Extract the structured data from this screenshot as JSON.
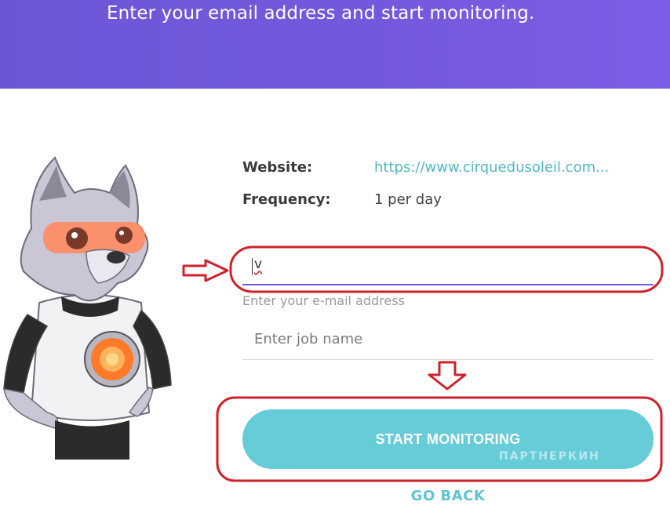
{
  "hero": {
    "tagline": "Enter your email address and start monitoring."
  },
  "summary": {
    "website_label": "Website:",
    "website_value": "https://www.cirquedusoleil.com...",
    "frequency_label": "Frequency:",
    "frequency_value": "1 per day"
  },
  "form": {
    "email_value": "v",
    "email_hint": "Enter your e-mail address",
    "job_placeholder": "Enter job name"
  },
  "actions": {
    "start_label": "START MONITORING",
    "back_label": "GO BACK"
  },
  "colors": {
    "hero_gradient_start": "#6b57d6",
    "hero_gradient_end": "#7d5ee6",
    "primary_button": "#66ccd8",
    "link": "#4fb8c8",
    "annotation_red": "#d0202a"
  },
  "icons": [
    "wolf-mascot-illustration",
    "right-arrow-annotation",
    "down-arrow-annotation"
  ]
}
